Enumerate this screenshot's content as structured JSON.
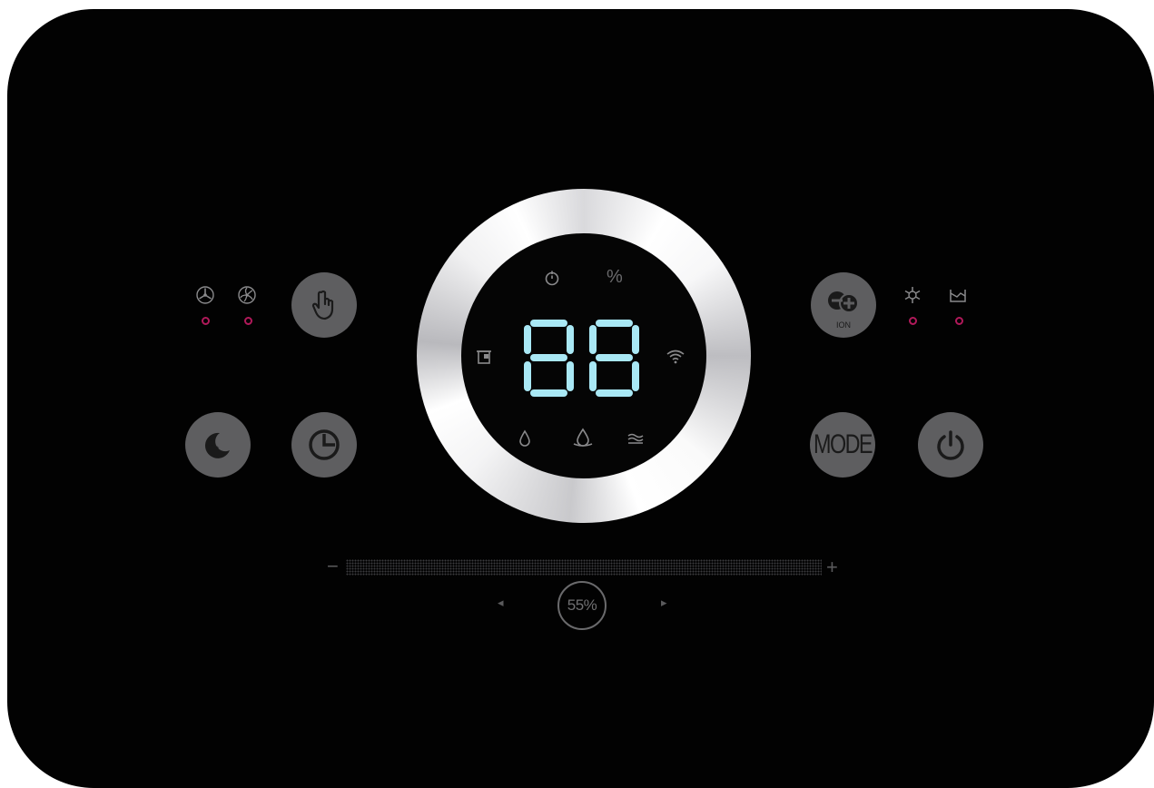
{
  "panel": {
    "background": "#020202",
    "led_color": "#b0195a",
    "digit_color": "#a9e8f5",
    "button_color": "#5e5e60"
  },
  "left_indicators": [
    {
      "icon": "fan-low-icon"
    },
    {
      "icon": "fan-high-icon"
    }
  ],
  "right_indicators": [
    {
      "icon": "defrost-icon"
    },
    {
      "icon": "tank-full-icon"
    }
  ],
  "buttons": {
    "touch": {
      "icon": "hand-pointer-icon"
    },
    "sleep": {
      "icon": "moon-stars-icon"
    },
    "timer": {
      "icon": "timer-pie-icon"
    },
    "ion": {
      "icon": "ion-minus-plus-icon",
      "label": "ION"
    },
    "mode": {
      "label": "MODE"
    },
    "power": {
      "icon": "power-icon"
    }
  },
  "display": {
    "value": "88",
    "percent_symbol": "%",
    "top_icons": [
      "timer-clock-icon"
    ],
    "side_icons": [
      "filter-icon",
      "wifi-icon"
    ],
    "bottom_icons": [
      "droplet-icon",
      "water-level-icon",
      "drying-icon"
    ]
  },
  "humidity_slider": {
    "minus": "−",
    "plus": "+",
    "value_label": "55%",
    "value_fraction": 0.55,
    "left_arrow": "◂",
    "right_arrow": "▸"
  }
}
